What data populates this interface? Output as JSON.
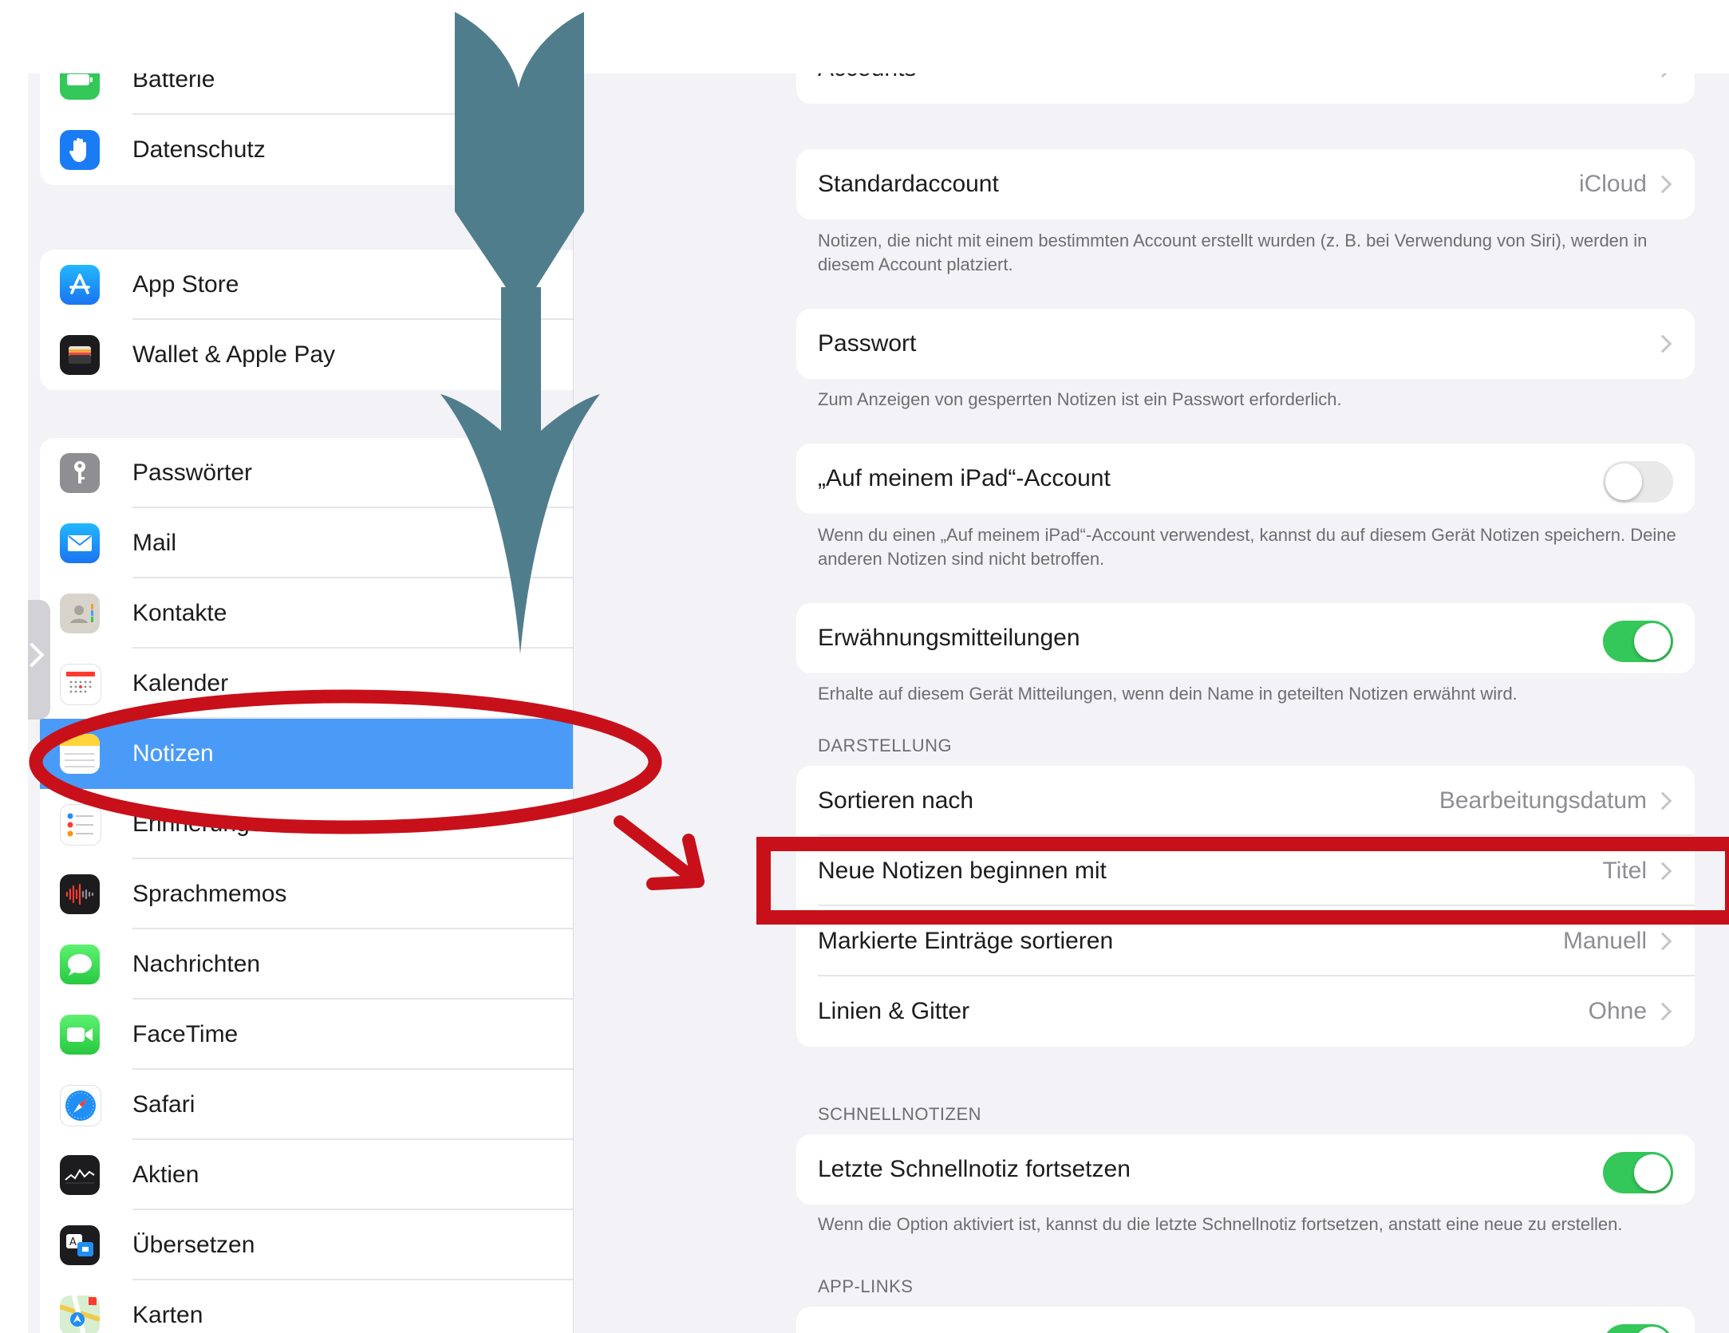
{
  "sidebar": {
    "groups": [
      [
        {
          "label": "Batterie",
          "icon": "battery-icon",
          "color": "#34c759"
        },
        {
          "label": "Datenschutz",
          "icon": "hand-icon",
          "color": "#1a7cf5"
        }
      ],
      [
        {
          "label": "App Store",
          "icon": "app-store-icon",
          "color": "#1f8ef5"
        },
        {
          "label": "Wallet & Apple Pay",
          "icon": "wallet-icon",
          "color": "#1c1c1e"
        }
      ],
      [
        {
          "label": "Passwörter",
          "icon": "key-icon",
          "color": "#8e8e93"
        },
        {
          "label": "Mail",
          "icon": "mail-icon",
          "color": "#1f8ef5"
        },
        {
          "label": "Kontakte",
          "icon": "contacts-icon",
          "color": "#c7c7cc"
        },
        {
          "label": "Kalender",
          "icon": "calendar-icon",
          "color": "#ffffff"
        },
        {
          "label": "Notizen",
          "icon": "notes-icon",
          "color": "#ffd43b",
          "selected": true
        },
        {
          "label": "Erinnerungen",
          "icon": "reminders-icon",
          "color": "#ffffff"
        },
        {
          "label": "Sprachmemos",
          "icon": "voice-memos-icon",
          "color": "#1c1c1e"
        },
        {
          "label": "Nachrichten",
          "icon": "messages-icon",
          "color": "#34c759"
        },
        {
          "label": "FaceTime",
          "icon": "facetime-icon",
          "color": "#34c759"
        },
        {
          "label": "Safari",
          "icon": "safari-icon",
          "color": "#1f8ef5"
        },
        {
          "label": "Aktien",
          "icon": "stocks-icon",
          "color": "#1c1c1e"
        },
        {
          "label": "Übersetzen",
          "icon": "translate-icon",
          "color": "#1c1c1e"
        },
        {
          "label": "Karten",
          "icon": "maps-icon",
          "color": "#5ac05a"
        }
      ]
    ]
  },
  "detail": {
    "accounts_label": "Accounts",
    "standardaccount": {
      "label": "Standardaccount",
      "value": "iCloud"
    },
    "standardaccount_note": "Notizen, die nicht mit einem bestimmten Account erstellt wurden (z. B. bei Verwendung von Siri), werden in diesem Account platziert.",
    "passwort": {
      "label": "Passwort"
    },
    "passwort_note": "Zum Anzeigen von gesperrten Notizen ist ein Passwort erforderlich.",
    "ipad_account": {
      "label": "„Auf meinem iPad“-Account",
      "on": false
    },
    "ipad_account_note": "Wenn du einen „Auf meinem iPad“-Account verwendest, kannst du auf diesem Gerät Notizen speichern. Deine anderen Notizen sind nicht betroffen.",
    "mentions": {
      "label": "Erwähnungsmitteilungen",
      "on": true
    },
    "mentions_note": "Erhalte auf diesem Gerät Mitteilungen, wenn dein Name in geteilten Notizen erwähnt wird.",
    "darstellung_header": "DARSTELLUNG",
    "darstellung": [
      {
        "label": "Sortieren nach",
        "value": "Bearbeitungsdatum"
      },
      {
        "label": "Neue Notizen beginnen mit",
        "value": "Titel"
      },
      {
        "label": "Markierte Einträge sortieren",
        "value": "Manuell"
      },
      {
        "label": "Linien & Gitter",
        "value": "Ohne"
      }
    ],
    "schnellnotizen_header": "SCHNELLNOTIZEN",
    "schnellnotiz": {
      "label": "Letzte Schnellnotiz fortsetzen",
      "on": true
    },
    "schnellnotiz_note": "Wenn die Option aktiviert ist, kannst du die letzte Schnellnotiz fortsetzen, anstatt eine neue zu erstellen.",
    "applinks_header": "APP-LINKS"
  },
  "colors": {
    "accent": "#4a9bf7",
    "toggle_on": "#34c759",
    "annotation_arrow": "#507d8c",
    "annotation_red": "#c8101a"
  }
}
